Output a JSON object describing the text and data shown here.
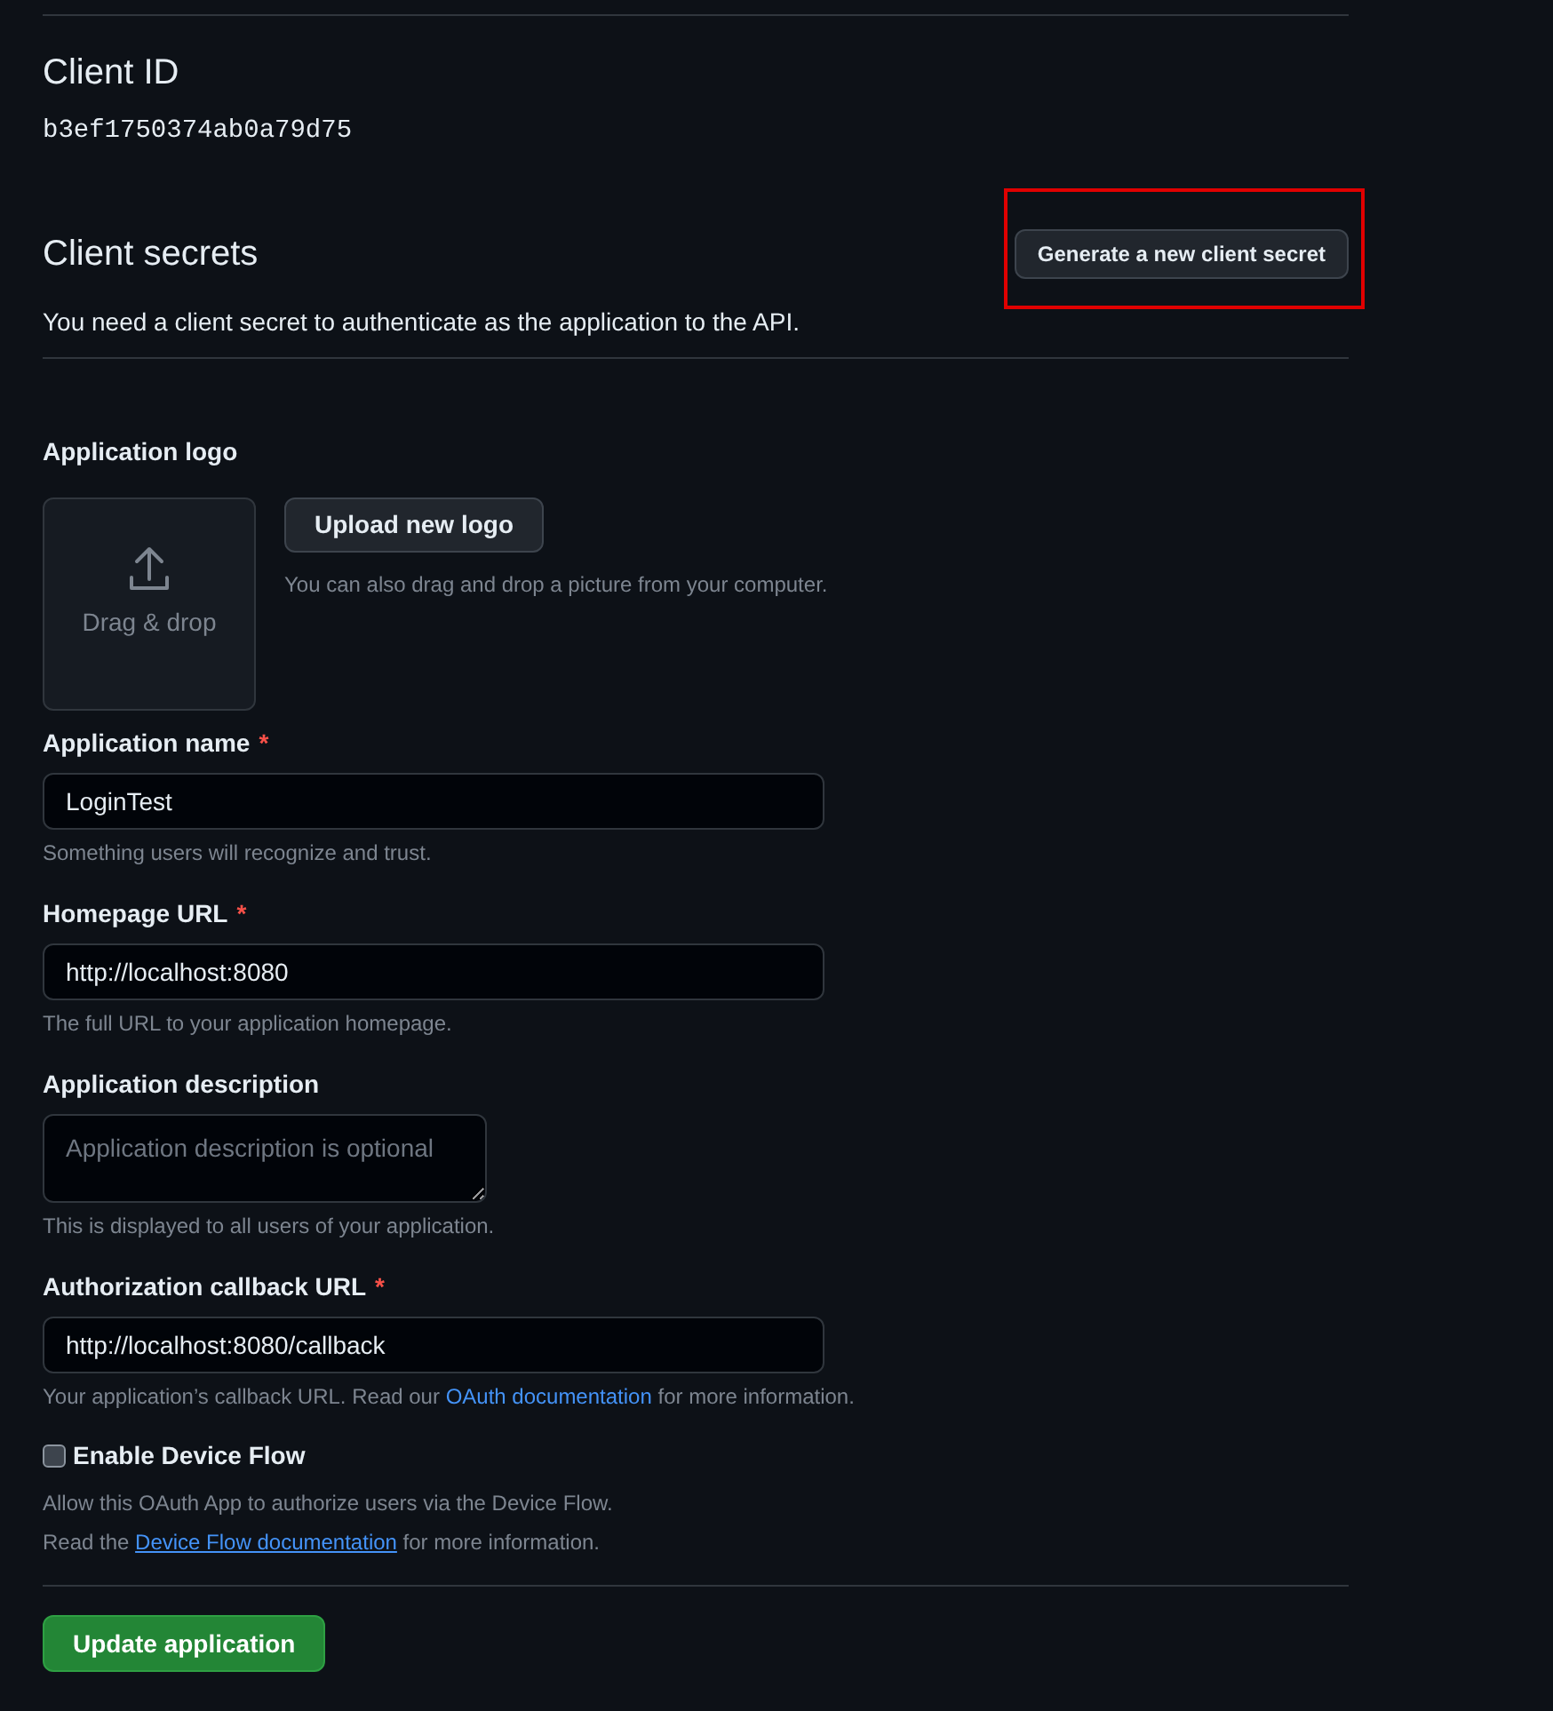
{
  "client_id": {
    "heading": "Client ID",
    "value": "b3ef1750374ab0a79d75"
  },
  "client_secrets": {
    "heading": "Client secrets",
    "generate_button": "Generate a new client secret",
    "highlighted": true,
    "description": "You need a client secret to authenticate as the application to the API."
  },
  "application_logo": {
    "label": "Application logo",
    "dropzone_text": "Drag & drop",
    "upload_button": "Upload new logo",
    "hint": "You can also drag and drop a picture from your computer."
  },
  "fields": [
    {
      "kind": "input",
      "label": "Application name",
      "required_mark": "*",
      "value": "LoginTest",
      "hint": "Something users will recognize and trust."
    },
    {
      "kind": "input",
      "label": "Homepage URL",
      "required_mark": "*",
      "value": "http://localhost:8080",
      "hint": "The full URL to your application homepage."
    },
    {
      "kind": "textarea",
      "label": "Application description",
      "placeholder": "Application description is optional",
      "hint": "This is displayed to all users of your application."
    },
    {
      "kind": "input",
      "label": "Authorization callback URL",
      "required_mark": "*",
      "value": "http://localhost:8080/callback",
      "hint": "Your application’s callback URL. Read our",
      "hint_link": "OAuth documentation",
      "hint_after": "for more information."
    }
  ],
  "device_flow": {
    "label": "Enable Device Flow",
    "checked": false,
    "description": "Allow this OAuth App to authorize users via the Device Flow.",
    "note": "Read the",
    "note_link": "Device Flow documentation",
    "note_after": "for more information."
  },
  "submit_button": "Update application"
}
